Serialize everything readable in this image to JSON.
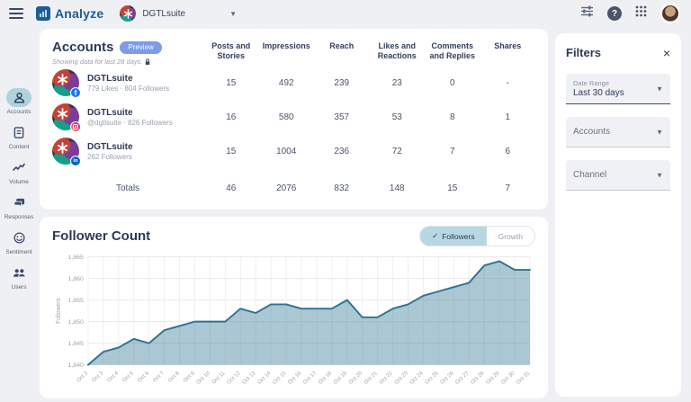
{
  "topbar": {
    "app_name": "Analyze",
    "brand": "DGTLsuite",
    "icons": [
      "hamburger-icon",
      "tune-icon",
      "help-icon",
      "apps-grid-icon",
      "user-avatar"
    ]
  },
  "sidebar": {
    "items": [
      {
        "label": "Accounts",
        "icon": "person-icon",
        "active": true
      },
      {
        "label": "Content",
        "icon": "document-icon",
        "active": false
      },
      {
        "label": "Volume",
        "icon": "line-chart-icon",
        "active": false
      },
      {
        "label": "Responses",
        "icon": "chat-icon",
        "active": false
      },
      {
        "label": "Sentiment",
        "icon": "smiley-icon",
        "active": false
      },
      {
        "label": "Users",
        "icon": "people-icon",
        "active": false
      }
    ]
  },
  "accounts_card": {
    "title": "Accounts",
    "badge": "Preview",
    "subtitle": "Showing data for last 28 days.",
    "columns": [
      "Posts and Stories",
      "Impressions",
      "Reach",
      "Likes and Reactions",
      "Comments and Replies",
      "Shares"
    ],
    "rows": [
      {
        "name": "DGTLsuite",
        "detail": "779 Likes · 804 Followers",
        "network": "facebook",
        "values": [
          "15",
          "492",
          "239",
          "23",
          "0",
          "-"
        ]
      },
      {
        "name": "DGTLsuite",
        "detail": "@dgtlsuite · 826 Followers",
        "network": "instagram",
        "values": [
          "16",
          "580",
          "357",
          "53",
          "8",
          "1"
        ]
      },
      {
        "name": "DGTLsuite",
        "detail": "262 Followers",
        "network": "linkedin",
        "values": [
          "15",
          "1004",
          "236",
          "72",
          "7",
          "6"
        ]
      }
    ],
    "totals_label": "Totals",
    "totals": [
      "46",
      "2076",
      "832",
      "148",
      "15",
      "7"
    ]
  },
  "follower_card": {
    "title": "Follower Count",
    "toggle": {
      "active": "Followers",
      "inactive": "Growth"
    }
  },
  "chart_data": {
    "type": "area",
    "title": "Follower Count",
    "xlabel": "",
    "ylabel": "Followers",
    "x": [
      "Oct 2",
      "Oct 3",
      "Oct 4",
      "Oct 5",
      "Oct 6",
      "Oct 7",
      "Oct 8",
      "Oct 9",
      "Oct 10",
      "Oct 11",
      "Oct 12",
      "Oct 13",
      "Oct 14",
      "Oct 15",
      "Oct 16",
      "Oct 17",
      "Oct 18",
      "Oct 19",
      "Oct 20",
      "Oct 21",
      "Oct 22",
      "Oct 23",
      "Oct 24",
      "Oct 25",
      "Oct 26",
      "Oct 27",
      "Oct 28",
      "Oct 29",
      "Oct 30",
      "Oct 31"
    ],
    "values": [
      1840,
      1843,
      1844,
      1846,
      1845,
      1848,
      1849,
      1850,
      1850,
      1850,
      1853,
      1852,
      1854,
      1854,
      1853,
      1853,
      1853,
      1855,
      1851,
      1851,
      1853,
      1854,
      1856,
      1857,
      1858,
      1859,
      1863,
      1864,
      1862,
      1862
    ],
    "ylim": [
      1840,
      1865
    ],
    "yticks": [
      1840,
      1845,
      1850,
      1855,
      1860,
      1865
    ],
    "grid": true,
    "legend_position": "none",
    "line_color": "#2e7392",
    "fill_color": "rgba(46,115,146,0.40)"
  },
  "filters": {
    "title": "Filters",
    "fields": [
      {
        "label": "Date Range",
        "value": "Last 30 days"
      },
      {
        "placeholder": "Accounts"
      },
      {
        "placeholder": "Channel"
      }
    ]
  }
}
